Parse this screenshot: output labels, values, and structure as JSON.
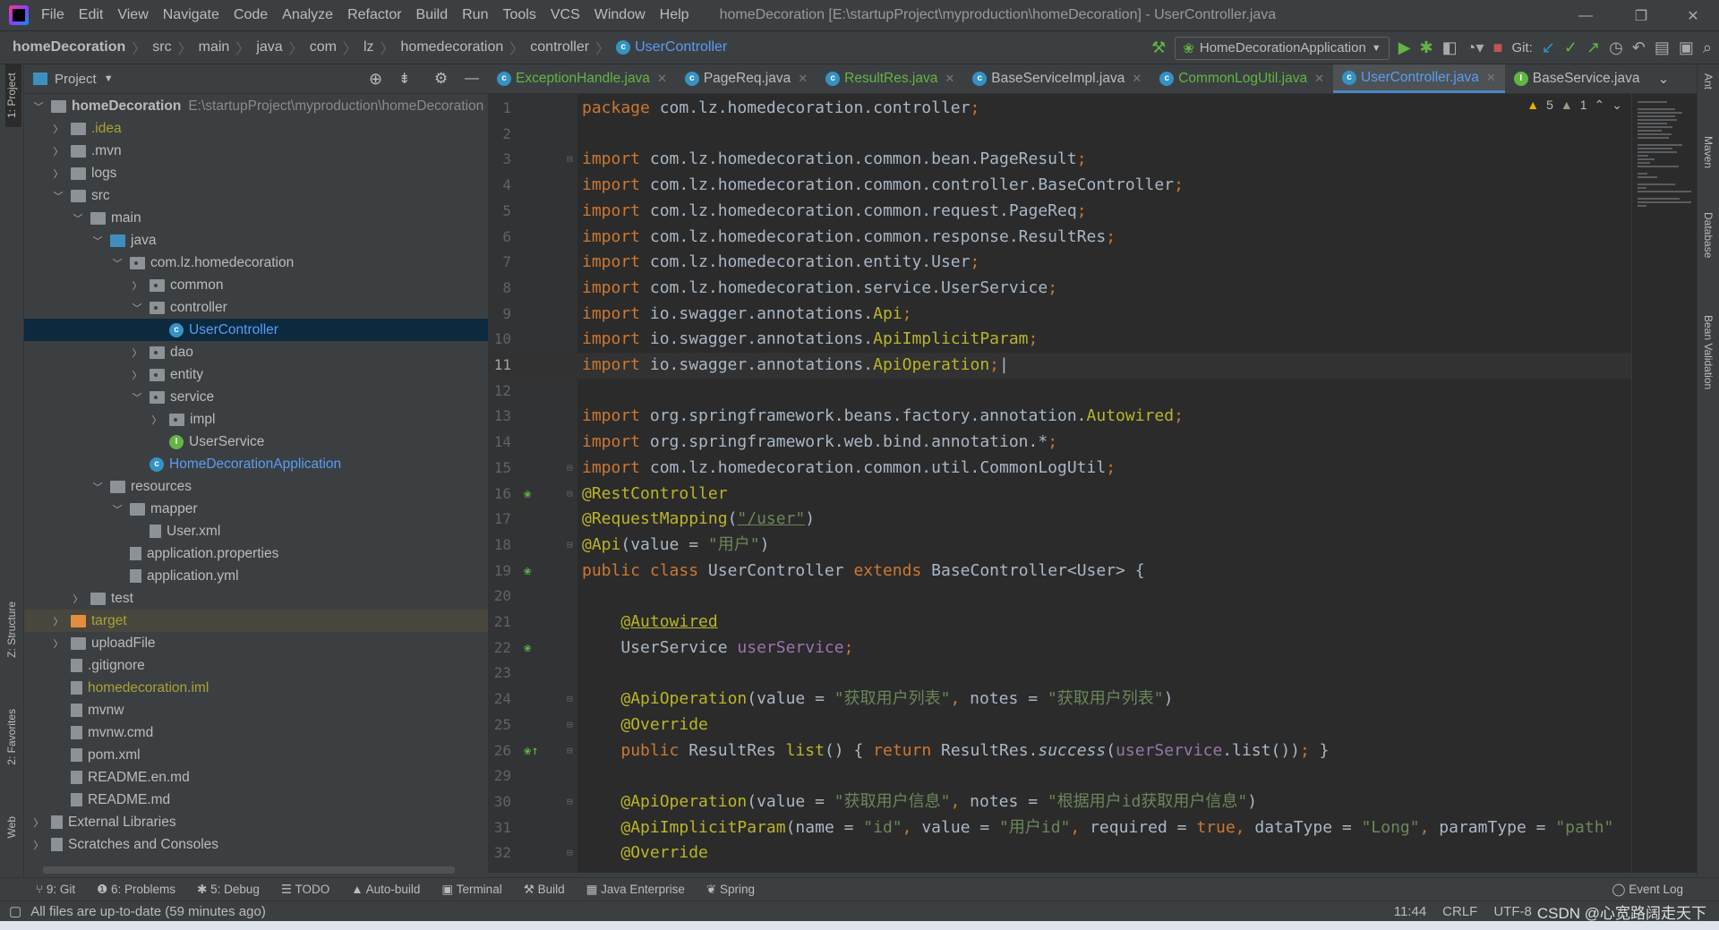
{
  "menubar": {
    "items": [
      "File",
      "Edit",
      "View",
      "Navigate",
      "Code",
      "Analyze",
      "Refactor",
      "Build",
      "Run",
      "Tools",
      "VCS",
      "Window",
      "Help"
    ],
    "window_title": "homeDecoration [E:\\startupProject\\myproduction\\homeDecoration] - UserController.java"
  },
  "breadcrumb": [
    "homeDecoration",
    "src",
    "main",
    "java",
    "com",
    "lz",
    "homedecoration",
    "controller",
    "UserController"
  ],
  "toolbar": {
    "run_config": "HomeDecorationApplication",
    "git_label": "Git:"
  },
  "project_panel": {
    "title": "Project",
    "root_path": "E:\\startupProject\\myproduction\\homeDecoration"
  },
  "tree": [
    {
      "label": "homeDecoration",
      "depth": 0,
      "arrow": "open",
      "icon": "module",
      "bold": true
    },
    {
      "label": ".idea",
      "depth": 1,
      "arrow": "closed",
      "icon": "folder",
      "color": "#a8a235"
    },
    {
      "label": ".mvn",
      "depth": 1,
      "arrow": "closed",
      "icon": "folder"
    },
    {
      "label": "logs",
      "depth": 1,
      "arrow": "closed",
      "icon": "folder"
    },
    {
      "label": "src",
      "depth": 1,
      "arrow": "open",
      "icon": "folder"
    },
    {
      "label": "main",
      "depth": 2,
      "arrow": "open",
      "icon": "folder"
    },
    {
      "label": "java",
      "depth": 3,
      "arrow": "open",
      "icon": "folder-blue"
    },
    {
      "label": "com.lz.homedecoration",
      "depth": 4,
      "arrow": "open",
      "icon": "package"
    },
    {
      "label": "common",
      "depth": 5,
      "arrow": "closed",
      "icon": "package"
    },
    {
      "label": "controller",
      "depth": 5,
      "arrow": "open",
      "icon": "package"
    },
    {
      "label": "UserController",
      "depth": 6,
      "arrow": "none",
      "icon": "class",
      "color": "#589df6",
      "selected": true
    },
    {
      "label": "dao",
      "depth": 5,
      "arrow": "closed",
      "icon": "package"
    },
    {
      "label": "entity",
      "depth": 5,
      "arrow": "closed",
      "icon": "package"
    },
    {
      "label": "service",
      "depth": 5,
      "arrow": "open",
      "icon": "package"
    },
    {
      "label": "impl",
      "depth": 6,
      "arrow": "closed",
      "icon": "package"
    },
    {
      "label": "UserService",
      "depth": 6,
      "arrow": "none",
      "icon": "interface"
    },
    {
      "label": "HomeDecorationApplication",
      "depth": 5,
      "arrow": "none",
      "icon": "spring-class",
      "color": "#589df6"
    },
    {
      "label": "resources",
      "depth": 3,
      "arrow": "open",
      "icon": "folder"
    },
    {
      "label": "mapper",
      "depth": 4,
      "arrow": "open",
      "icon": "folder"
    },
    {
      "label": "User.xml",
      "depth": 5,
      "arrow": "none",
      "icon": "xml-file"
    },
    {
      "label": "application.properties",
      "depth": 4,
      "arrow": "none",
      "icon": "config-file"
    },
    {
      "label": "application.yml",
      "depth": 4,
      "arrow": "none",
      "icon": "config-file"
    },
    {
      "label": "test",
      "depth": 2,
      "arrow": "closed",
      "icon": "folder"
    },
    {
      "label": "target",
      "depth": 1,
      "arrow": "closed",
      "icon": "folder-orange",
      "color": "#a8a235",
      "excluded": true
    },
    {
      "label": "uploadFile",
      "depth": 1,
      "arrow": "closed",
      "icon": "folder"
    },
    {
      "label": ".gitignore",
      "depth": 1,
      "arrow": "none",
      "icon": "file"
    },
    {
      "label": "homedecoration.iml",
      "depth": 1,
      "arrow": "none",
      "icon": "file",
      "color": "#a8a235"
    },
    {
      "label": "mvnw",
      "depth": 1,
      "arrow": "none",
      "icon": "file"
    },
    {
      "label": "mvnw.cmd",
      "depth": 1,
      "arrow": "none",
      "icon": "file"
    },
    {
      "label": "pom.xml",
      "depth": 1,
      "arrow": "none",
      "icon": "maven-file"
    },
    {
      "label": "README.en.md",
      "depth": 1,
      "arrow": "none",
      "icon": "md-file"
    },
    {
      "label": "README.md",
      "depth": 1,
      "arrow": "none",
      "icon": "md-file"
    },
    {
      "label": "External Libraries",
      "depth": 0,
      "arrow": "closed",
      "icon": "library"
    },
    {
      "label": "Scratches and Consoles",
      "depth": 0,
      "arrow": "closed",
      "icon": "scratches"
    }
  ],
  "tabs": [
    {
      "label": "ExceptionHandle.java",
      "type": "class",
      "green": true
    },
    {
      "label": "PageReq.java",
      "type": "class"
    },
    {
      "label": "ResultRes.java",
      "type": "class",
      "green": true
    },
    {
      "label": "BaseServiceImpl.java",
      "type": "class"
    },
    {
      "label": "CommonLogUtil.java",
      "type": "class",
      "green": true
    },
    {
      "label": "UserController.java",
      "type": "class",
      "active": true
    },
    {
      "label": "BaseService.java",
      "type": "interface"
    }
  ],
  "inspections": {
    "warnings": "5",
    "weak_warnings": "1"
  },
  "editor": {
    "current_line": "11",
    "lines": [
      {
        "n": "1",
        "t": [
          [
            "package ",
            "kw"
          ],
          [
            "com.lz.homedecoration.controller",
            "df"
          ],
          [
            ";",
            "kw"
          ]
        ]
      },
      {
        "n": "2",
        "t": []
      },
      {
        "n": "3",
        "t": [
          [
            "import ",
            "kw"
          ],
          [
            "com.lz.homedecoration.common.bean.PageResult",
            "df"
          ],
          [
            ";",
            "kw"
          ]
        ],
        "fold": true
      },
      {
        "n": "4",
        "t": [
          [
            "import ",
            "kw"
          ],
          [
            "com.lz.homedecoration.common.controller.BaseController",
            "df"
          ],
          [
            ";",
            "kw"
          ]
        ]
      },
      {
        "n": "5",
        "t": [
          [
            "import ",
            "kw"
          ],
          [
            "com.lz.homedecoration.common.request.PageReq",
            "df"
          ],
          [
            ";",
            "kw"
          ]
        ]
      },
      {
        "n": "6",
        "t": [
          [
            "import ",
            "kw"
          ],
          [
            "com.lz.homedecoration.common.response.ResultRes",
            "df"
          ],
          [
            ";",
            "kw"
          ]
        ]
      },
      {
        "n": "7",
        "t": [
          [
            "import ",
            "kw"
          ],
          [
            "com.lz.homedecoration.entity.User",
            "df"
          ],
          [
            ";",
            "kw"
          ]
        ]
      },
      {
        "n": "8",
        "t": [
          [
            "import ",
            "kw"
          ],
          [
            "com.lz.homedecoration.service.UserService",
            "df"
          ],
          [
            ";",
            "kw"
          ]
        ]
      },
      {
        "n": "9",
        "t": [
          [
            "import ",
            "kw"
          ],
          [
            "io.swagger.annotations.",
            "df"
          ],
          [
            "Api",
            "an"
          ],
          [
            ";",
            "kw"
          ]
        ]
      },
      {
        "n": "10",
        "t": [
          [
            "import ",
            "kw"
          ],
          [
            "io.swagger.annotations.",
            "df"
          ],
          [
            "ApiImplicitParam",
            "an"
          ],
          [
            ";",
            "kw"
          ]
        ]
      },
      {
        "n": "11",
        "t": [
          [
            "import ",
            "kw"
          ],
          [
            "io.swagger.annotations.",
            "df"
          ],
          [
            "ApiOperation",
            "an"
          ],
          [
            ";",
            "kw"
          ],
          [
            "|",
            "df"
          ]
        ]
      },
      {
        "n": "12",
        "t": []
      },
      {
        "n": "13",
        "t": [
          [
            "import ",
            "kw"
          ],
          [
            "org.springframework.beans.factory.annotation.",
            "df"
          ],
          [
            "Autowired",
            "an"
          ],
          [
            ";",
            "kw"
          ]
        ]
      },
      {
        "n": "14",
        "t": [
          [
            "import ",
            "kw"
          ],
          [
            "org.springframework.web.bind.annotation.*",
            "df"
          ],
          [
            ";",
            "kw"
          ]
        ]
      },
      {
        "n": "15",
        "t": [
          [
            "import ",
            "kw"
          ],
          [
            "com.lz.homedecoration.common.util.CommonLogUtil",
            "df"
          ],
          [
            ";",
            "kw"
          ]
        ],
        "fold": true
      },
      {
        "n": "16",
        "t": [
          [
            "@RestController",
            "an"
          ]
        ],
        "fold": true,
        "gicon": "spring-bean-icon"
      },
      {
        "n": "17",
        "t": [
          [
            "@RequestMapping",
            "an"
          ],
          [
            "(",
            "df"
          ],
          [
            "\"/user\"",
            "st ul"
          ],
          [
            ")",
            "df"
          ]
        ]
      },
      {
        "n": "18",
        "t": [
          [
            "@Api",
            "an"
          ],
          [
            "(value = ",
            "df"
          ],
          [
            "\"用户\"",
            "st"
          ],
          [
            ")",
            "df"
          ]
        ],
        "fold": true
      },
      {
        "n": "19",
        "t": [
          [
            "public class ",
            "kw"
          ],
          [
            "UserController ",
            "df"
          ],
          [
            "extends ",
            "kw"
          ],
          [
            "BaseController<User> {",
            "df"
          ]
        ],
        "gicon": "spring-bean-icon"
      },
      {
        "n": "20",
        "t": []
      },
      {
        "n": "21",
        "t": [
          [
            "    ",
            "df"
          ],
          [
            "@Autowired",
            "an ul"
          ]
        ]
      },
      {
        "n": "22",
        "t": [
          [
            "    UserService ",
            "df"
          ],
          [
            "userService",
            "fd"
          ],
          [
            ";",
            "kw"
          ]
        ],
        "gicon": "spring-bean-icon"
      },
      {
        "n": "23",
        "t": []
      },
      {
        "n": "24",
        "t": [
          [
            "    ",
            "df"
          ],
          [
            "@ApiOperation",
            "an"
          ],
          [
            "(value = ",
            "df"
          ],
          [
            "\"获取用户列表\"",
            "st"
          ],
          [
            ", ",
            "kw"
          ],
          [
            "notes = ",
            "df"
          ],
          [
            "\"获取用户列表\"",
            "st"
          ],
          [
            ")",
            "df"
          ]
        ],
        "fold": true
      },
      {
        "n": "25",
        "t": [
          [
            "    ",
            "df"
          ],
          [
            "@Override",
            "an"
          ]
        ],
        "fold": true
      },
      {
        "n": "26",
        "t": [
          [
            "    ",
            "df"
          ],
          [
            "public ",
            "kw"
          ],
          [
            "ResultRes ",
            "df"
          ],
          [
            "list",
            "an"
          ],
          [
            "() { ",
            "df"
          ],
          [
            "return ",
            "kw"
          ],
          [
            "ResultRes.",
            "df"
          ],
          [
            "success",
            "it"
          ],
          [
            "(",
            "df"
          ],
          [
            "userService",
            "fd"
          ],
          [
            ".list())",
            "df"
          ],
          [
            ";",
            "kw"
          ],
          [
            " }",
            "df"
          ]
        ],
        "fold": true,
        "gicon": "override-icon"
      },
      {
        "n": "29",
        "t": []
      },
      {
        "n": "30",
        "t": [
          [
            "    ",
            "df"
          ],
          [
            "@ApiOperation",
            "an"
          ],
          [
            "(value = ",
            "df"
          ],
          [
            "\"获取用户信息\"",
            "st"
          ],
          [
            ", ",
            "kw"
          ],
          [
            "notes = ",
            "df"
          ],
          [
            "\"根据用户id获取用户信息\"",
            "st"
          ],
          [
            ")",
            "df"
          ]
        ],
        "fold": true
      },
      {
        "n": "31",
        "t": [
          [
            "    ",
            "df"
          ],
          [
            "@ApiImplicitParam",
            "an"
          ],
          [
            "(name = ",
            "df"
          ],
          [
            "\"id\"",
            "st"
          ],
          [
            ", ",
            "kw"
          ],
          [
            "value = ",
            "df"
          ],
          [
            "\"用户id\"",
            "st"
          ],
          [
            ", ",
            "kw"
          ],
          [
            "required = ",
            "df"
          ],
          [
            "true",
            "kw"
          ],
          [
            ", ",
            "kw"
          ],
          [
            "dataType = ",
            "df"
          ],
          [
            "\"Long\"",
            "st"
          ],
          [
            ", ",
            "kw"
          ],
          [
            "paramType = ",
            "df"
          ],
          [
            "\"path\"",
            "st"
          ]
        ]
      },
      {
        "n": "32",
        "t": [
          [
            "    ",
            "df"
          ],
          [
            "@Override",
            "an"
          ]
        ],
        "fold": true
      }
    ]
  },
  "left_stripe": [
    "1: Project",
    "Z: Structure",
    "2: Favorites",
    "Web"
  ],
  "right_stripe": [
    "Ant",
    "Maven",
    "Database",
    "Bean Validation"
  ],
  "bottom_tools": [
    "9: Git",
    "6: Problems",
    "5: Debug",
    "TODO",
    "Auto-build",
    "Terminal",
    "Build",
    "Java Enterprise",
    "Spring"
  ],
  "event_log": "Event Log",
  "status": {
    "message": "All files are up-to-date (59 minutes ago)",
    "position": "11:44",
    "line_sep": "CRLF",
    "encoding": "UTF-8",
    "watermark": "CSDN @心宽路阔走天下"
  },
  "colors": {
    "keyword": "#cc7832",
    "annotation": "#bbb529",
    "string": "#6a8759",
    "field": "#9876aa",
    "text": "#a9b7c6",
    "accent": "#4a88c7",
    "editor_bg": "#2b2b2b",
    "panel_bg": "#3c3f41"
  }
}
